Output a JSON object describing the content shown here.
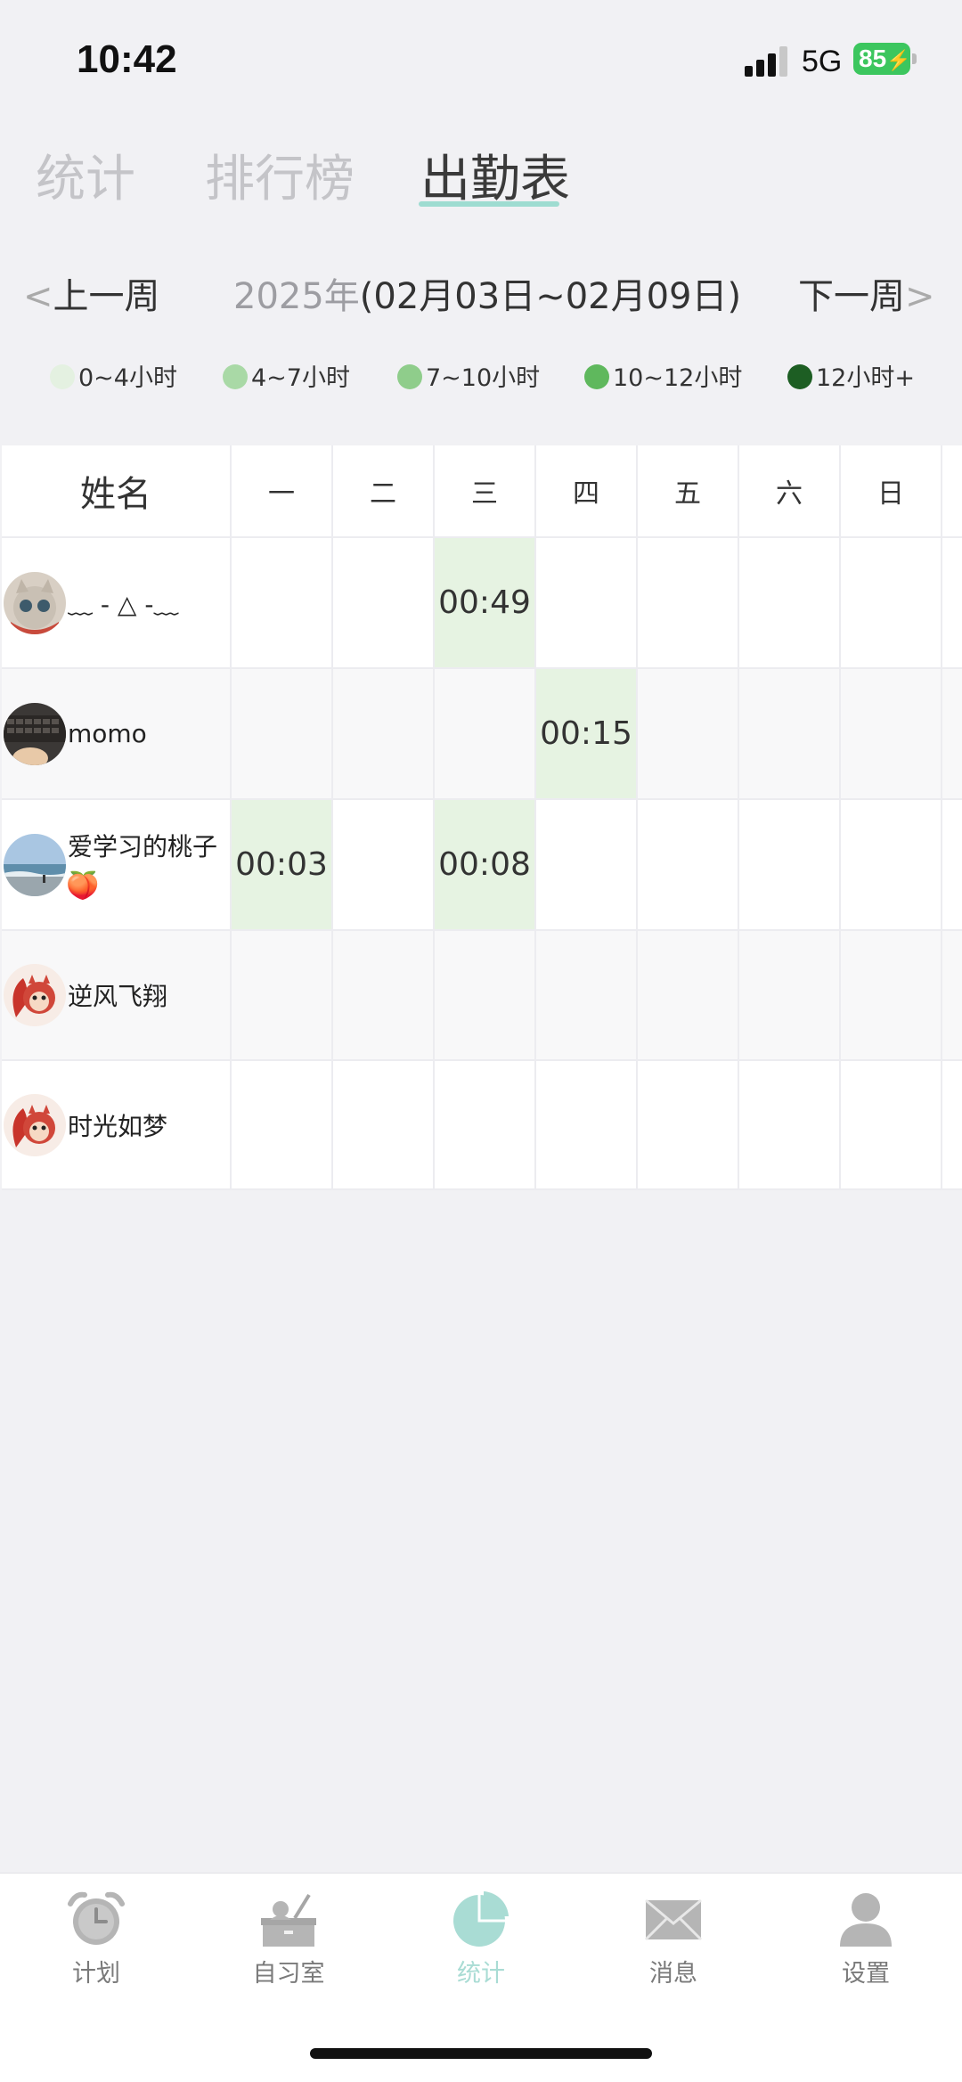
{
  "status_bar": {
    "time": "10:42",
    "network": "5G",
    "battery": "85"
  },
  "tabs": [
    {
      "label": "统计",
      "active": false
    },
    {
      "label": "排行榜",
      "active": false
    },
    {
      "label": "出勤表",
      "active": true
    }
  ],
  "week_nav": {
    "prev_chevron": "<",
    "prev_label": "上一周",
    "year": "2025年",
    "range": "(02月03日~02月09日)",
    "next_label": "下一周",
    "next_chevron": ">"
  },
  "legend": [
    {
      "label": "0~4小时",
      "color": "#e4f1e1"
    },
    {
      "label": "4~7小时",
      "color": "#a9d9a6"
    },
    {
      "label": "7~10小时",
      "color": "#8fcd8b"
    },
    {
      "label": "10~12小时",
      "color": "#5fb85d"
    },
    {
      "label": "12小时+",
      "color": "#1d5e23"
    }
  ],
  "table": {
    "headers": [
      "姓名",
      "一",
      "二",
      "三",
      "四",
      "五",
      "六",
      "日"
    ],
    "rows": [
      {
        "name": "﹏ - △ -﹏",
        "avatar": "cat-avatar",
        "cells": [
          "",
          "",
          "00:49",
          "",
          "",
          "",
          ""
        ]
      },
      {
        "name": "momo",
        "avatar": "keyboard-avatar",
        "cells": [
          "",
          "",
          "",
          "00:15",
          "",
          "",
          ""
        ]
      },
      {
        "name": "爱学习的桃子",
        "emoji": "🍑",
        "avatar": "beach-avatar",
        "cells": [
          "00:03",
          "",
          "00:08",
          "",
          "",
          "",
          ""
        ]
      },
      {
        "name": "逆风飞翔",
        "avatar": "squirrel-avatar",
        "cells": [
          "",
          "",
          "",
          "",
          "",
          "",
          ""
        ]
      },
      {
        "name": "时光如梦",
        "avatar": "squirrel-avatar",
        "cells": [
          "",
          "",
          "",
          "",
          "",
          "",
          ""
        ]
      }
    ]
  },
  "bottom_nav": [
    {
      "label": "计划",
      "icon": "alarm-clock-icon",
      "active": false
    },
    {
      "label": "自习室",
      "icon": "study-desk-icon",
      "active": false
    },
    {
      "label": "统计",
      "icon": "pie-chart-icon",
      "active": true
    },
    {
      "label": "消息",
      "icon": "mail-icon",
      "active": false
    },
    {
      "label": "设置",
      "icon": "person-icon",
      "active": false
    }
  ],
  "colors": {
    "accent": "#9edcd1",
    "cell_fill": "#e6f3e2"
  }
}
